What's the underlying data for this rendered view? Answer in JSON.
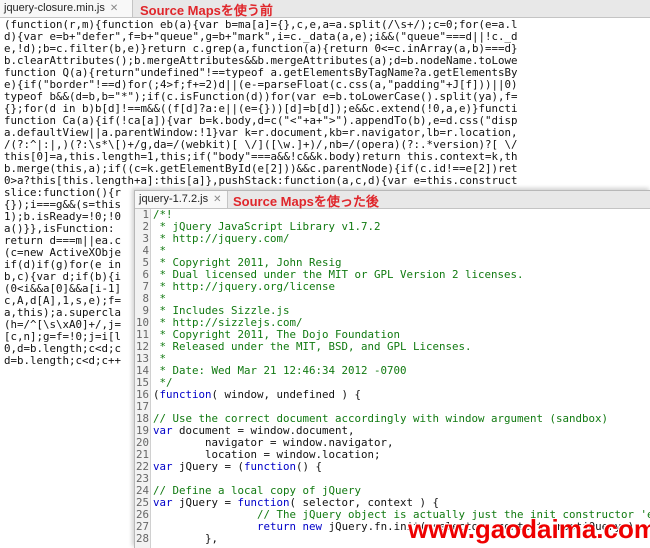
{
  "back_tab": {
    "label": "jquery-closure.min.js",
    "close": "✕"
  },
  "back_annotation": "Source Mapsを使う前",
  "front_tab": {
    "label": "jquery-1.7.2.js",
    "close": "✕"
  },
  "front_annotation": "Source Mapsを使った後",
  "watermark": "www.gaodaima.com",
  "back_lines": [
    "(function(r,m){function eb(a){var b=ma[a]={},c,e,a=a.split(/\\s+/);c=0;for(e=a.l",
    "d){var e=b+\"defer\",f=b+\"queue\",g=b+\"mark\",i=c._data(a,e);i&&(\"queue\"===d||!c._d",
    "e,!d);b=c.filter(b,e)}return c.grep(a,function(a){return 0<=c.inArray(a,b)===d}",
    "b.clearAttributes();b.mergeAttributes&&b.mergeAttributes(a);d=b.nodeName.toLowe",
    "function Q(a){return\"undefined\"!==typeof a.getElementsByTagName?a.getElementsBy",
    "e){if(\"border\"!==d)for(;4>f;f+=2)d||(e-=parseFloat(c.css(a,\"padding\"+J[f]))||0)",
    "typeof b&&(d=b,b=\"*\");if(c.isFunction(d))for(var e=b.toLowerCase().split(ya),f=",
    "{};for(d in b)b[d]!==m&&((f[d]?a:e||(e={}))[d]=b[d]);e&&c.extend(!0,a,e)}functi",
    "function Ca(a){if(!ca[a]){var b=k.body,d=c(\"<\"+a+\">\").appendTo(b),e=d.css(\"disp",
    "a.defaultView||a.parentWindow:!1}var k=r.document,kb=r.navigator,lb=r.location,",
    "/(?:^|:|,)(?:\\s*\\[)+/g,da=/(webkit)[ \\/]([\\w.]+)/,nb=/(opera)(?:.*version)?[ \\/",
    "this[0]=a,this.length=1,this;if(\"body\"===a&&!c&&k.body)return this.context=k,th",
    "b.merge(this,a);if((c=k.getElementById(e[2]))&&c.parentNode){if(c.id!==e[2])ret",
    "0>a?this[this.length+a]:this[a]},pushStack:function(a,c,d){var e=this.construct",
    "slice:function(){r",
    "{});i===g&&(s=this",
    "1);b.isReady=!0;!0",
    "a()}},isFunction:",
    "return d===m||ea.c",
    "(c=new ActiveXObje",
    "if(d)if(g)for(e in",
    "b,c){var d;if(b){i",
    "(0<i&&a[0]&&a[i-1]",
    "c,A,d[A],1,s,e);f=",
    "a,this);a.supercla",
    "(h=/^[\\s\\xA0]+/,j=",
    "[c,n];g=f=!0;j=i[l",
    "0,d=b.length;c<d;c",
    "d=b.length;c<d;c++"
  ],
  "gutter_numbers": [
    "1",
    "2",
    "3",
    "4",
    "5",
    "6",
    "7",
    "8",
    "9",
    "10",
    "11",
    "12",
    "13",
    "14",
    "15",
    "16",
    "17",
    "18",
    "19",
    "20",
    "21",
    "22",
    "23",
    "24",
    "25",
    "26",
    "27",
    "28"
  ],
  "front_lines": [
    [
      {
        "t": "/*!",
        "c": "cm"
      }
    ],
    [
      {
        "t": " * jQuery JavaScript Library v1.7.2",
        "c": "cm"
      }
    ],
    [
      {
        "t": " * http://jquery.com/",
        "c": "cm"
      }
    ],
    [
      {
        "t": " *",
        "c": "cm"
      }
    ],
    [
      {
        "t": " * Copyright 2011, John Resig",
        "c": "cm"
      }
    ],
    [
      {
        "t": " * Dual licensed under the MIT or GPL Version 2 licenses.",
        "c": "cm"
      }
    ],
    [
      {
        "t": " * http://jquery.org/license",
        "c": "cm"
      }
    ],
    [
      {
        "t": " *",
        "c": "cm"
      }
    ],
    [
      {
        "t": " * Includes Sizzle.js",
        "c": "cm"
      }
    ],
    [
      {
        "t": " * http://sizzlejs.com/",
        "c": "cm"
      }
    ],
    [
      {
        "t": " * Copyright 2011, The Dojo Foundation",
        "c": "cm"
      }
    ],
    [
      {
        "t": " * Released under the MIT, BSD, and GPL Licenses.",
        "c": "cm"
      }
    ],
    [
      {
        "t": " *",
        "c": "cm"
      }
    ],
    [
      {
        "t": " * Date: Wed Mar 21 12:46:34 2012 -0700",
        "c": "cm"
      }
    ],
    [
      {
        "t": " */",
        "c": "cm"
      }
    ],
    [
      {
        "t": "(",
        "c": ""
      },
      {
        "t": "function",
        "c": "kw"
      },
      {
        "t": "( window, undefined ) {",
        "c": ""
      }
    ],
    [
      {
        "t": "",
        "c": ""
      }
    ],
    [
      {
        "t": "// Use the correct document accordingly with window argument (sandbox)",
        "c": "cm"
      }
    ],
    [
      {
        "t": "var",
        "c": "kw"
      },
      {
        "t": " document = window.document,",
        "c": ""
      }
    ],
    [
      {
        "t": "        navigator = window.navigator,",
        "c": ""
      }
    ],
    [
      {
        "t": "        location = window.location;",
        "c": ""
      }
    ],
    [
      {
        "t": "var",
        "c": "kw"
      },
      {
        "t": " jQuery = (",
        "c": ""
      },
      {
        "t": "function",
        "c": "kw"
      },
      {
        "t": "() {",
        "c": ""
      }
    ],
    [
      {
        "t": "",
        "c": ""
      }
    ],
    [
      {
        "t": "// Define a local copy of jQuery",
        "c": "cm"
      }
    ],
    [
      {
        "t": "var",
        "c": "kw"
      },
      {
        "t": " jQuery = ",
        "c": ""
      },
      {
        "t": "function",
        "c": "kw"
      },
      {
        "t": "( selector, context ) {",
        "c": ""
      }
    ],
    [
      {
        "t": "                // The jQuery object is actually just the init constructor 'e",
        "c": "cm"
      }
    ],
    [
      {
        "t": "                ",
        "c": ""
      },
      {
        "t": "return",
        "c": "kw"
      },
      {
        "t": " ",
        "c": ""
      },
      {
        "t": "new",
        "c": "kw"
      },
      {
        "t": " jQuery.fn.init( selector, context, rootjQuery );",
        "c": ""
      }
    ],
    [
      {
        "t": "        },",
        "c": ""
      }
    ]
  ]
}
